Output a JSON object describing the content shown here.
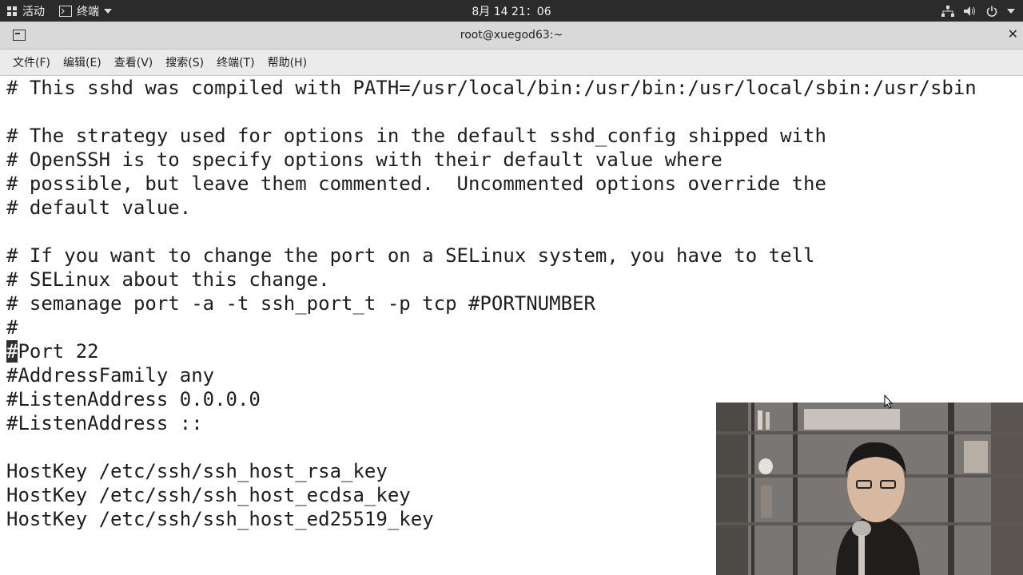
{
  "topbar": {
    "activities_label": "活动",
    "terminal_label": "终端",
    "datetime": "8月 14 21：06"
  },
  "window": {
    "title": "root@xuegod63:~"
  },
  "menu": [
    "文件(F)",
    "编辑(E)",
    "查看(V)",
    "搜索(S)",
    "终端(T)",
    "帮助(H)"
  ],
  "terminal": {
    "lines": [
      "# This sshd was compiled with PATH=/usr/local/bin:/usr/bin:/usr/local/sbin:/usr/sbin",
      "",
      "# The strategy used for options in the default sshd_config shipped with",
      "# OpenSSH is to specify options with their default value where",
      "# possible, but leave them commented.  Uncommented options override the",
      "# default value.",
      "",
      "# If you want to change the port on a SELinux system, you have to tell",
      "# SELinux about this change.",
      "# semanage port -a -t ssh_port_t -p tcp #PORTNUMBER",
      "#",
      "Port 22",
      "#AddressFamily any",
      "#ListenAddress 0.0.0.0",
      "#ListenAddress ::",
      "",
      "HostKey /etc/ssh/ssh_host_rsa_key",
      "HostKey /etc/ssh/ssh_host_ecdsa_key",
      "HostKey /etc/ssh/ssh_host_ed25519_key"
    ],
    "cursor_char": "#"
  }
}
